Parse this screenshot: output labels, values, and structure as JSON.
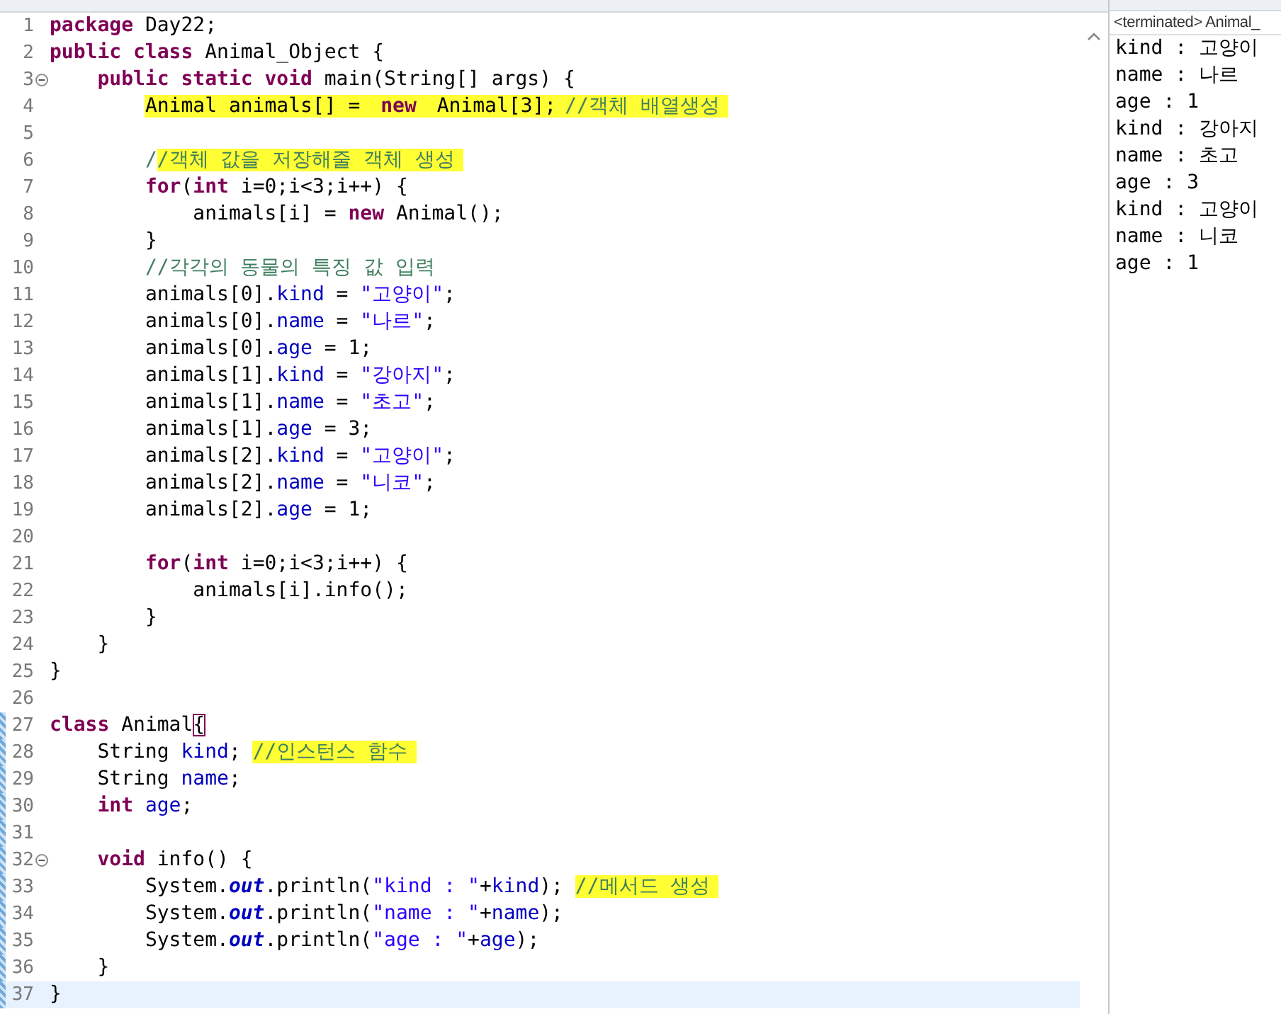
{
  "editor": {
    "lines": [
      {
        "number": "1",
        "tokens": [
          {
            "kind": "keyword",
            "text": "package"
          },
          {
            "kind": "plain",
            "text": " Day22;"
          }
        ]
      },
      {
        "number": "2",
        "tokens": [
          {
            "kind": "keyword",
            "text": "public class"
          },
          {
            "kind": "plain",
            "text": " Animal_Object {"
          }
        ]
      },
      {
        "number": "3",
        "collapsible": true,
        "tokens": [
          {
            "kind": "keyword",
            "text": "    public static void"
          },
          {
            "kind": "plain",
            "text": " main(String[] args) {"
          }
        ]
      },
      {
        "number": "4",
        "tokens": [
          {
            "kind": "plain",
            "text": "        Animal animals[] = ",
            "marked": true
          },
          {
            "kind": "keyword",
            "text": "new",
            "marked": true
          },
          {
            "kind": "plain",
            "text": " Animal[3];",
            "marked": true
          },
          {
            "kind": "comment",
            "text": "//객체 배열생성",
            "marked": true
          }
        ]
      },
      {
        "number": "5"
      },
      {
        "number": "6",
        "tokens": [
          {
            "kind": "comment",
            "text": "        /"
          },
          {
            "kind": "comment",
            "text": "/객체 값을 저장해줄 객체 생성",
            "marked": true
          }
        ]
      },
      {
        "number": "7",
        "tokens": [
          {
            "kind": "keyword",
            "text": "        for"
          },
          {
            "kind": "plain",
            "text": "("
          },
          {
            "kind": "keyword",
            "text": "int"
          },
          {
            "kind": "plain",
            "text": " i=0;i<3;i++) {"
          }
        ]
      },
      {
        "number": "8",
        "tokens": [
          {
            "kind": "plain",
            "text": "            animals[i] = "
          },
          {
            "kind": "keyword",
            "text": "new"
          },
          {
            "kind": "plain",
            "text": " Animal();"
          }
        ]
      },
      {
        "number": "9",
        "tokens": [
          {
            "kind": "plain",
            "text": "        }"
          }
        ]
      },
      {
        "number": "10",
        "tokens": [
          {
            "kind": "comment",
            "text": "        //각각의 동물의 특징 값 입력"
          }
        ]
      },
      {
        "number": "11",
        "tokens": [
          {
            "kind": "plain",
            "text": "        animals[0]."
          },
          {
            "kind": "field",
            "text": "kind"
          },
          {
            "kind": "plain",
            "text": " = "
          },
          {
            "kind": "string",
            "text": "\"고양이\""
          },
          {
            "kind": "plain",
            "text": ";"
          }
        ]
      },
      {
        "number": "12",
        "tokens": [
          {
            "kind": "plain",
            "text": "        animals[0]."
          },
          {
            "kind": "field",
            "text": "name"
          },
          {
            "kind": "plain",
            "text": " = "
          },
          {
            "kind": "string",
            "text": "\"나르\""
          },
          {
            "kind": "plain",
            "text": ";"
          }
        ]
      },
      {
        "number": "13",
        "tokens": [
          {
            "kind": "plain",
            "text": "        animals[0]."
          },
          {
            "kind": "field",
            "text": "age"
          },
          {
            "kind": "plain",
            "text": " = 1;"
          }
        ]
      },
      {
        "number": "14",
        "tokens": [
          {
            "kind": "plain",
            "text": "        animals[1]."
          },
          {
            "kind": "field",
            "text": "kind"
          },
          {
            "kind": "plain",
            "text": " = "
          },
          {
            "kind": "string",
            "text": "\"강아지\""
          },
          {
            "kind": "plain",
            "text": ";"
          }
        ]
      },
      {
        "number": "15",
        "tokens": [
          {
            "kind": "plain",
            "text": "        animals[1]."
          },
          {
            "kind": "field",
            "text": "name"
          },
          {
            "kind": "plain",
            "text": " = "
          },
          {
            "kind": "string",
            "text": "\"초고\""
          },
          {
            "kind": "plain",
            "text": ";"
          }
        ]
      },
      {
        "number": "16",
        "tokens": [
          {
            "kind": "plain",
            "text": "        animals[1]."
          },
          {
            "kind": "field",
            "text": "age"
          },
          {
            "kind": "plain",
            "text": " = 3;"
          }
        ]
      },
      {
        "number": "17",
        "tokens": [
          {
            "kind": "plain",
            "text": "        animals[2]."
          },
          {
            "kind": "field",
            "text": "kind"
          },
          {
            "kind": "plain",
            "text": " = "
          },
          {
            "kind": "string",
            "text": "\"고양이\""
          },
          {
            "kind": "plain",
            "text": ";"
          }
        ]
      },
      {
        "number": "18",
        "tokens": [
          {
            "kind": "plain",
            "text": "        animals[2]."
          },
          {
            "kind": "field",
            "text": "name"
          },
          {
            "kind": "plain",
            "text": " = "
          },
          {
            "kind": "string",
            "text": "\"니코\""
          },
          {
            "kind": "plain",
            "text": ";"
          }
        ]
      },
      {
        "number": "19",
        "tokens": [
          {
            "kind": "plain",
            "text": "        animals[2]."
          },
          {
            "kind": "field",
            "text": "age"
          },
          {
            "kind": "plain",
            "text": " = 1;"
          }
        ]
      },
      {
        "number": "20"
      },
      {
        "number": "21",
        "tokens": [
          {
            "kind": "keyword",
            "text": "        for"
          },
          {
            "kind": "plain",
            "text": "("
          },
          {
            "kind": "keyword",
            "text": "int"
          },
          {
            "kind": "plain",
            "text": " i=0;i<3;i++) {"
          }
        ]
      },
      {
        "number": "22",
        "tokens": [
          {
            "kind": "plain",
            "text": "            animals[i].info();"
          }
        ]
      },
      {
        "number": "23",
        "tokens": [
          {
            "kind": "plain",
            "text": "        }"
          }
        ]
      },
      {
        "number": "24",
        "tokens": [
          {
            "kind": "plain",
            "text": "    }"
          }
        ]
      },
      {
        "number": "25",
        "tokens": [
          {
            "kind": "plain",
            "text": "}"
          }
        ]
      },
      {
        "number": "26"
      },
      {
        "number": "27",
        "changed": true,
        "tokens": [
          {
            "kind": "keyword",
            "text": "class"
          },
          {
            "kind": "plain",
            "text": " Animal"
          },
          {
            "kind": "matched-bracket",
            "text": "{"
          }
        ]
      },
      {
        "number": "28",
        "changed": true,
        "tokens": [
          {
            "kind": "plain",
            "text": "    String "
          },
          {
            "kind": "field",
            "text": "kind"
          },
          {
            "kind": "plain",
            "text": "; "
          },
          {
            "kind": "comment",
            "text": "//인스턴스 함수",
            "marked": true
          }
        ]
      },
      {
        "number": "29",
        "changed": true,
        "tokens": [
          {
            "kind": "plain",
            "text": "    String "
          },
          {
            "kind": "field",
            "text": "name"
          },
          {
            "kind": "plain",
            "text": ";"
          }
        ]
      },
      {
        "number": "30",
        "changed": true,
        "tokens": [
          {
            "kind": "keyword",
            "text": "    int "
          },
          {
            "kind": "field",
            "text": "age"
          },
          {
            "kind": "plain",
            "text": ";"
          }
        ]
      },
      {
        "number": "31",
        "changed": true
      },
      {
        "number": "32",
        "collapsible": true,
        "changed": true,
        "tokens": [
          {
            "kind": "keyword",
            "text": "    void"
          },
          {
            "kind": "plain",
            "text": " info() {"
          }
        ]
      },
      {
        "number": "33",
        "changed": true,
        "tokens": [
          {
            "kind": "plain",
            "text": "        System."
          },
          {
            "kind": "static-field",
            "text": "out"
          },
          {
            "kind": "plain",
            "text": ".println("
          },
          {
            "kind": "string",
            "text": "\"kind : \""
          },
          {
            "kind": "plain",
            "text": "+"
          },
          {
            "kind": "field",
            "text": "kind"
          },
          {
            "kind": "plain",
            "text": "); "
          },
          {
            "kind": "comment",
            "text": "//메서드 생성",
            "marked": true
          }
        ]
      },
      {
        "number": "34",
        "changed": true,
        "tokens": [
          {
            "kind": "plain",
            "text": "        System."
          },
          {
            "kind": "static-field",
            "text": "out"
          },
          {
            "kind": "plain",
            "text": ".println("
          },
          {
            "kind": "string",
            "text": "\"name : \""
          },
          {
            "kind": "plain",
            "text": "+"
          },
          {
            "kind": "field",
            "text": "name"
          },
          {
            "kind": "plain",
            "text": ");"
          }
        ]
      },
      {
        "number": "35",
        "changed": true,
        "tokens": [
          {
            "kind": "plain",
            "text": "        System."
          },
          {
            "kind": "static-field",
            "text": "out"
          },
          {
            "kind": "plain",
            "text": ".println("
          },
          {
            "kind": "string",
            "text": "\"age : \""
          },
          {
            "kind": "plain",
            "text": "+"
          },
          {
            "kind": "field",
            "text": "age"
          },
          {
            "kind": "plain",
            "text": ");"
          }
        ]
      },
      {
        "number": "36",
        "changed": true,
        "tokens": [
          {
            "kind": "plain",
            "text": "    }"
          }
        ]
      },
      {
        "number": "37",
        "changed": true,
        "current": true,
        "tokens": [
          {
            "kind": "plain",
            "text": "}"
          }
        ]
      }
    ]
  },
  "console": {
    "header": "<terminated> Animal_",
    "lines": [
      "kind : 고양이",
      "name : 나르",
      "age : 1",
      "kind : 강아지",
      "name : 초고",
      "age : 3",
      "kind : 고양이",
      "name : 니코",
      "age : 1"
    ]
  }
}
